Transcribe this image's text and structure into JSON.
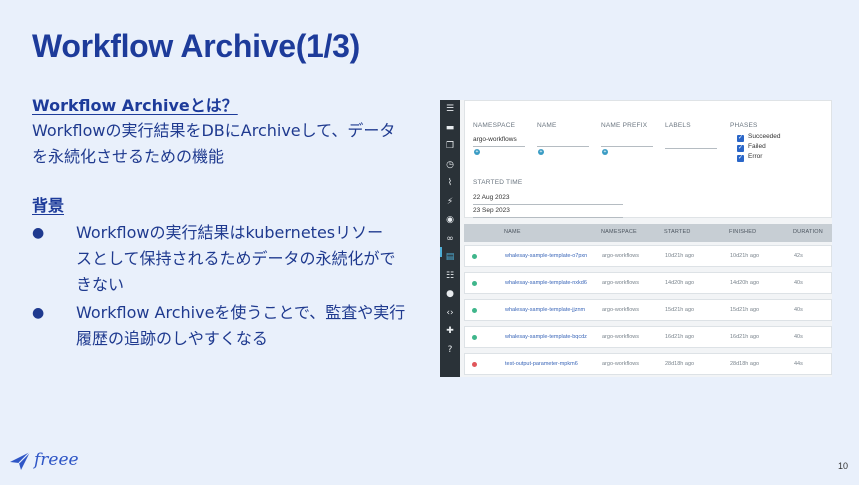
{
  "slide": {
    "title": "Workflow Archive(1/3)",
    "section1_heading": "Workflow Archiveとは？",
    "section1_body_line1": "Workflowの実行結果をDBにArchiveして、データ",
    "section1_body_line2": "を永続化させるための機能",
    "section2_heading": "背景",
    "bullets": [
      {
        "lines": [
          "Workflowの実行結果はkubernetesリソー",
          "スとして保持されるためデータの永続化がで",
          "きない"
        ]
      },
      {
        "lines": [
          "Workflow Archiveを使うことで、監査や実行",
          "履歴の追跡のしやすくなる"
        ]
      }
    ],
    "bullet_glyph": "●",
    "page_number": "10",
    "logo_text": "freee"
  },
  "screenshot": {
    "nav_icons": [
      "menu-icon",
      "archive-icon",
      "copy-icon",
      "clock-icon",
      "antenna-icon",
      "bolt-icon",
      "satellite-icon",
      "link-icon",
      "archive-active-icon",
      "report-icon",
      "user-icon",
      "code-icon",
      "puzzle-icon",
      "help-icon"
    ],
    "filters": {
      "namespace_label": "NAMESPACE",
      "namespace_value": "argo-workflows",
      "name_label": "NAME",
      "name_prefix_label": "NAME PREFIX",
      "labels_label": "LABELS",
      "phases_label": "PHASES",
      "phases": [
        "Succeeded",
        "Failed",
        "Error"
      ],
      "started_time_label": "STARTED TIME",
      "start_date": "22 Aug 2023",
      "end_date": "23 Sep 2023"
    },
    "columns": [
      "NAME",
      "NAMESPACE",
      "STARTED",
      "FINISHED",
      "DURATION"
    ],
    "rows": [
      {
        "status": "success",
        "name": "whalesay-sample-template-o7pxn",
        "namespace": "argo-workflows",
        "started": "10d21h ago",
        "finished": "10d21h ago",
        "duration": "42s"
      },
      {
        "status": "success",
        "name": "whalesay-sample-template-nxkd6",
        "namespace": "argo-workflows",
        "started": "14d20h ago",
        "finished": "14d20h ago",
        "duration": "40s"
      },
      {
        "status": "success",
        "name": "whalesay-sample-template-jjznm",
        "namespace": "argo-workflows",
        "started": "15d21h ago",
        "finished": "15d21h ago",
        "duration": "40s"
      },
      {
        "status": "success",
        "name": "whalesay-sample-template-bqcdz",
        "namespace": "argo-workflows",
        "started": "16d21h ago",
        "finished": "16d21h ago",
        "duration": "40s"
      },
      {
        "status": "failed",
        "name": "test-output-parameter-mpkm6",
        "namespace": "argo-workflows",
        "started": "28d18h ago",
        "finished": "28d18h ago",
        "duration": "44s"
      }
    ],
    "status_colors": {
      "success": "#3fb68b",
      "failed": "#e0565b"
    }
  }
}
